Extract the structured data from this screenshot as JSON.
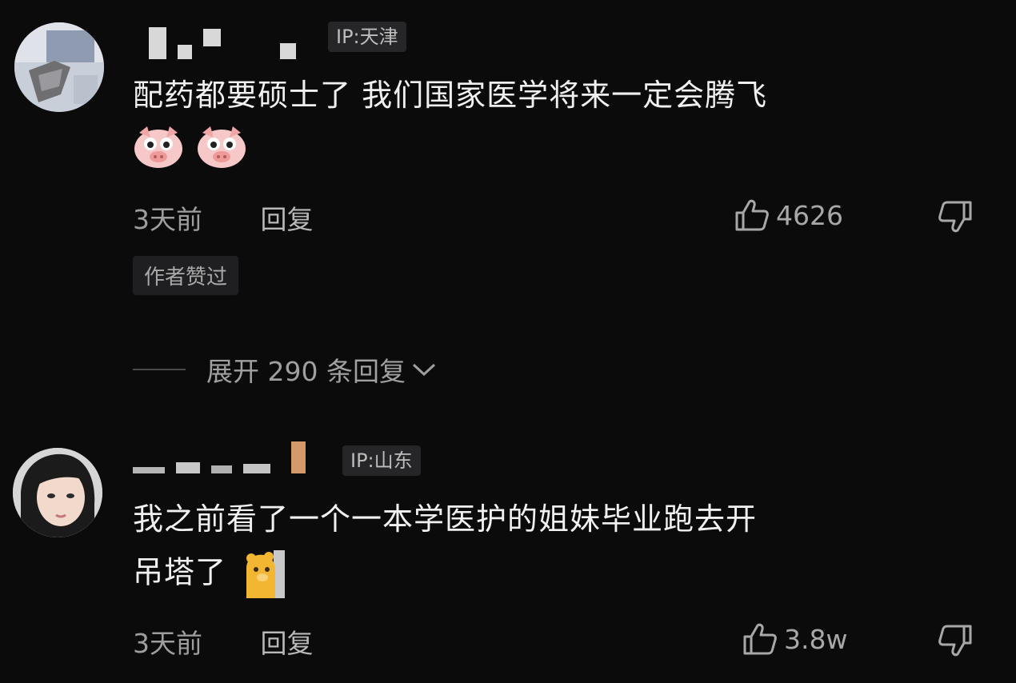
{
  "comments": [
    {
      "ip": "IP:天津",
      "text_line1": "配药都要硕士了 我们国家医学将来一定会腾飞",
      "time": "3天前",
      "reply_label": "回复",
      "likes": "4626",
      "author_liked": "作者赞过",
      "expand_replies": "展开 290 条回复",
      "emoji": [
        "pig-face-emoji",
        "pig-face-emoji"
      ]
    },
    {
      "ip": "IP:山东",
      "text_line1": "我之前看了一个一本学医护的姐妹毕业跑去开",
      "text_line2": "吊塔了",
      "time": "3天前",
      "reply_label": "回复",
      "likes": "3.8w",
      "emoji": [
        "bear-peek-emoji"
      ]
    }
  ],
  "colors": {
    "background": "#0b0b0c",
    "text": "#f0f0f0",
    "muted": "#9e9e9e",
    "badge_bg": "#262628"
  }
}
